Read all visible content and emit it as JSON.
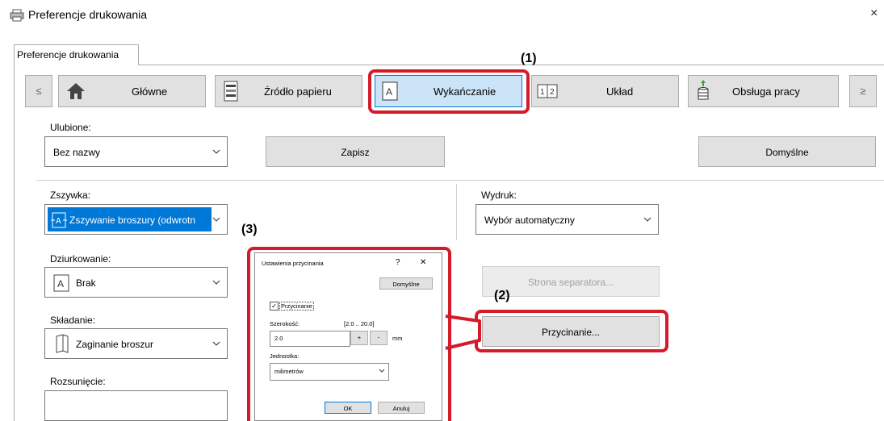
{
  "window": {
    "title": "Preferencje drukowania",
    "close": "×"
  },
  "tab_label": "Preferencje drukowania",
  "ribbon": {
    "prev": "≤",
    "next": "≥",
    "tabs": [
      {
        "label": "Główne",
        "icon": "home-icon"
      },
      {
        "label": "Źródło papieru",
        "icon": "paper-tray-icon"
      },
      {
        "label": "Wykańczanie",
        "icon": "finishing-icon",
        "active": true
      },
      {
        "label": "Układ",
        "icon": "layout-icon"
      },
      {
        "label": "Obsługa pracy",
        "icon": "job-handling-icon"
      }
    ]
  },
  "favorites": {
    "label": "Ulubione:",
    "value": "Bez nazwy",
    "save_label": "Zapisz",
    "default_label": "Domyślne"
  },
  "finishing": {
    "staple_label": "Zszywka:",
    "staple_value": "Zszywanie broszury (odwrotn",
    "punch_label": "Dziurkowanie:",
    "punch_value": "Brak",
    "fold_label": "Składanie:",
    "fold_value": "Zaginanie broszur",
    "offset_label": "Rozsunięcie:",
    "output_label": "Wydruk:",
    "output_value": "Wybór automatyczny",
    "separator_button": "Strona separatora...",
    "trim_button": "Przycinanie..."
  },
  "callouts": {
    "c1": "(1)",
    "c2": "(2)",
    "c3": "(3)"
  },
  "trim_dialog": {
    "title": "Ustawienia przycinania",
    "help": "?",
    "close": "✕",
    "default_button": "Domyślne",
    "trim_checkbox": "Przycinanie",
    "width_label": "Szerokość:",
    "width_range": "[2.0 .. 20.0]",
    "width_value": "2.0",
    "width_plus": "+",
    "width_minus": "-",
    "width_unit": "mm",
    "unit_label": "Jednostka:",
    "unit_value": "milimetrów",
    "ok": "OK",
    "cancel": "Anuluj"
  },
  "colors": {
    "accent": "#0078d7",
    "highlight": "#d51b2a",
    "selection": "#0078d7"
  }
}
